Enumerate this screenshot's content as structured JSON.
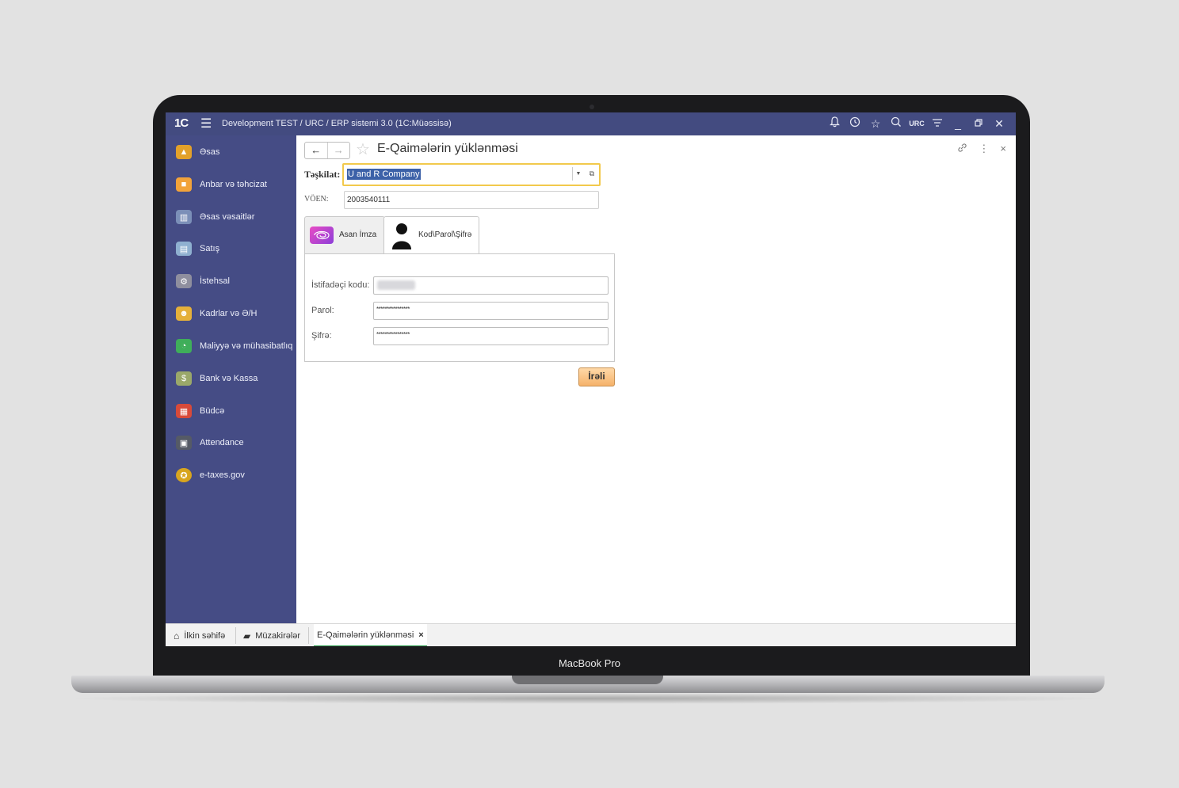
{
  "device_label": "MacBook Pro",
  "app": {
    "logo": "1C",
    "title": "Development TEST / URC / ERP sistemi 3.0  (1C:Müəssisə)",
    "user_badge": "URC"
  },
  "sidebar": {
    "items": [
      {
        "label": "Əsas",
        "icon": "home-desk-icon",
        "color": "#e3a12a"
      },
      {
        "label": "Anbar və təhcizat",
        "icon": "boxes-icon",
        "color": "#f2a33a"
      },
      {
        "label": "Əsas vəsaitlər",
        "icon": "buildings-icon",
        "color": "#7b8fb8"
      },
      {
        "label": "Satış",
        "icon": "cash-register-icon",
        "color": "#8fb0d0"
      },
      {
        "label": "İstehsal",
        "icon": "gear-icon",
        "color": "#8e8e9e"
      },
      {
        "label": "Kadrlar və Ə/H",
        "icon": "people-icon",
        "color": "#e5b03a"
      },
      {
        "label": "Maliyyə və mühasibatlıq",
        "icon": "pie-chart-icon",
        "color": "#3fae5a"
      },
      {
        "label": "Bank və Kassa",
        "icon": "money-icon",
        "color": "#9aa86a"
      },
      {
        "label": "Büdcə",
        "icon": "calendar-icon",
        "color": "#d84a3a"
      },
      {
        "label": "Attendance",
        "icon": "terminal-icon",
        "color": "#555a66"
      },
      {
        "label": "e-taxes.gov",
        "icon": "emblem-icon",
        "color": "#d8a51e"
      }
    ]
  },
  "form": {
    "title": "E-Qaimələrin yüklənməsi",
    "organization_label": "Təşkilat:",
    "organization_value": "U and R Company",
    "voen_label": "VÖEN:",
    "voen_value": "2003540111",
    "tabs": [
      {
        "label": "Asan İmza"
      },
      {
        "label": "Kod\\Parol\\Şifrə"
      }
    ],
    "fields": {
      "user_code_label": "İstifadəçi kodu:",
      "password_label": "Parol:",
      "password_value": "****************",
      "cipher_label": "Şifrə:",
      "cipher_value": "****************"
    },
    "next_button": "İrəli"
  },
  "taskbar": {
    "items": [
      {
        "label": "İlkin səhifə",
        "icon": "home-icon"
      },
      {
        "label": "Müzakirələr",
        "icon": "chat-icon"
      },
      {
        "label": "E-Qaimələrin yüklənməsi",
        "close": "×"
      }
    ]
  }
}
